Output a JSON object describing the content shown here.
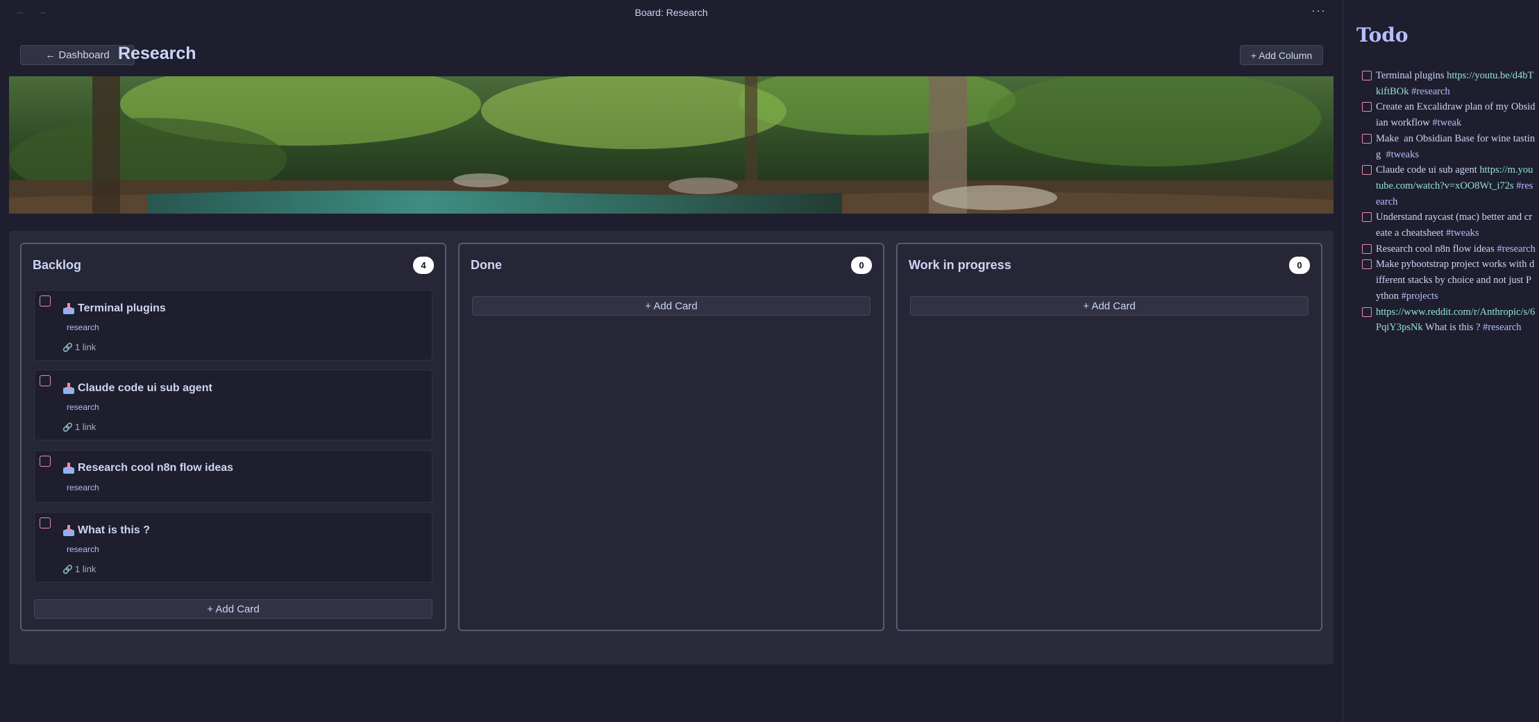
{
  "titlebar": {
    "title": "Board: Research",
    "back_icon": "←",
    "forward_icon": "→",
    "more_icon": "···"
  },
  "header": {
    "dashboard_label": "← Dashboard",
    "page_title": "Research",
    "add_column_label": "+ Add Column"
  },
  "banner": {
    "description": "forest-river-banner"
  },
  "columns": [
    {
      "title": "Backlog",
      "count": "4",
      "add_card_label": "+ Add Card",
      "cards": [
        {
          "title": "Terminal plugins",
          "tag": "research",
          "links": "1 link"
        },
        {
          "title": "Claude code ui sub agent",
          "tag": "research",
          "links": "1 link"
        },
        {
          "title": "Research cool n8n flow ideas",
          "tag": "research",
          "links": ""
        },
        {
          "title": "What is this ?",
          "tag": "research",
          "links": "1 link"
        }
      ]
    },
    {
      "title": "Done",
      "count": "0",
      "add_card_label": "+ Add Card",
      "cards": []
    },
    {
      "title": "Work in progress",
      "count": "0",
      "add_card_label": "+ Add Card",
      "cards": []
    }
  ],
  "sidebar": {
    "title": "Todo",
    "items": [
      {
        "text": "Terminal plugins ",
        "link": "https://youtu.be/d4bTkiftBOk",
        "tag": "#research"
      },
      {
        "text": "Create an Excalidraw plan of my Obsidian workflow ",
        "link": "",
        "tag": "#tweak"
      },
      {
        "text": "Make  an Obsidian Base for wine tasting  ",
        "link": "",
        "tag": "#tweaks"
      },
      {
        "text": "Claude code ui sub agent ",
        "link": "https://m.youtube.com/watch?v=xOO8Wt_i72s",
        "tag": "#research"
      },
      {
        "text": "Understand raycast (mac) better and create a cheatsheet ",
        "link": "",
        "tag": "#tweaks"
      },
      {
        "text": "Research cool n8n flow ideas ",
        "link": "",
        "tag": "#research"
      },
      {
        "text": "Make pybootstrap project works with different stacks by choice and not just Python ",
        "link": "",
        "tag": "#projects"
      },
      {
        "text": "",
        "link": "https://www.reddit.com/r/Anthropic/s/6PqiY3psNk",
        "after": " What is this ? ",
        "tag": "#research"
      }
    ]
  },
  "colors": {
    "background": "#1e1e2e",
    "panel": "#2a2a3b",
    "accent": "#b4befe",
    "checkbox": "#f38ba8",
    "link": "#94e2d5"
  }
}
